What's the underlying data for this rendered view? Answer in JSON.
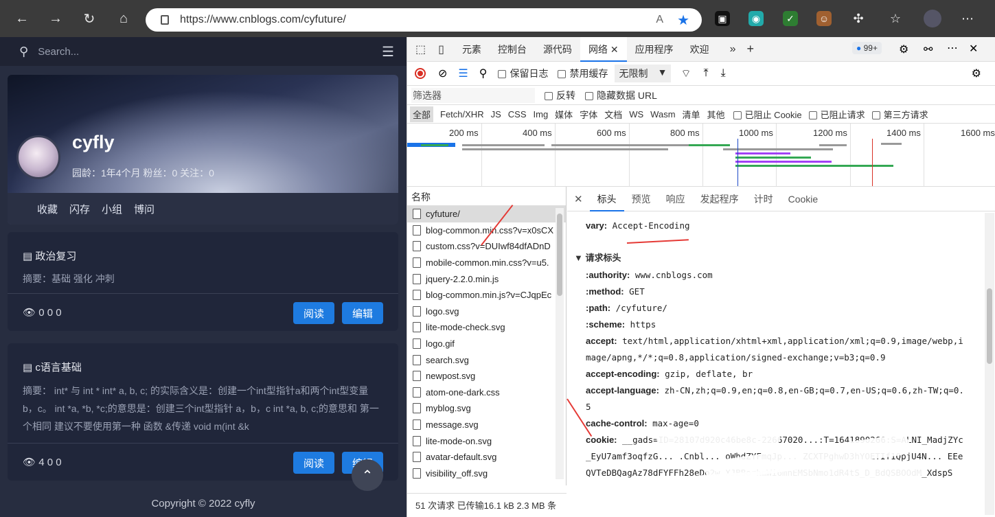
{
  "browser": {
    "url": "https://www.cnblogs.com/cyfuture/",
    "read_aloud": "A",
    "ext_badge": "99+"
  },
  "blog": {
    "search_placeholder": "Search...",
    "name": "cyfly",
    "stats": "园龄：1年4个月   粉丝：0   关注：0",
    "nav": [
      "收藏",
      "闪存",
      "小组",
      "博问"
    ],
    "posts": [
      {
        "title": "政治复习",
        "summary": "摘要：基础 强化 冲刺",
        "stats": "0  0  0",
        "read": "阅读",
        "edit": "编辑"
      },
      {
        "title": "c语言基础",
        "summary": "摘要： int* 与 int * int* a, b, c; 的实际含义是：创建一个int型指针a和两个int型变量b，c。 int *a, *b, *c;的意思是：创建三个int型指针 a，b，c int *a, b, c;的意思和 第一个相同 建议不要使用第一种 函数 &传递 void m(int &k",
        "stats": "4  0  0",
        "read": "阅读",
        "edit": "编辑"
      }
    ],
    "copyright": "Copyright © 2022 cyfly"
  },
  "devtools": {
    "tabs": [
      "元素",
      "控制台",
      "源代码",
      "网络",
      "应用程序",
      "欢迎"
    ],
    "active_tab": "网络",
    "toolbar": {
      "preserve_log": "保留日志",
      "disable_cache": "禁用缓存",
      "throttle": "无限制"
    },
    "filter": {
      "placeholder": "筛选器",
      "invert": "反转",
      "hide_data_url": "隐藏数据 URL"
    },
    "types": [
      "全部",
      "Fetch/XHR",
      "JS",
      "CSS",
      "Img",
      "媒体",
      "字体",
      "文档",
      "WS",
      "Wasm",
      "清单",
      "其他"
    ],
    "type_checks": [
      "已阻止 Cookie",
      "已阻止请求",
      "第三方请求"
    ],
    "timeline_ticks": [
      "200 ms",
      "400 ms",
      "600 ms",
      "800 ms",
      "1000 ms",
      "1200 ms",
      "1400 ms",
      "1600 ms"
    ],
    "name_header": "名称",
    "files": [
      "cyfuture/",
      "blog-common.min.css?v=x0sCX",
      "custom.css?v=DUIwf84dfADnD",
      "mobile-common.min.css?v=u5.",
      "jquery-2.2.0.min.js",
      "blog-common.min.js?v=CJqpEc",
      "logo.svg",
      "lite-mode-check.svg",
      "logo.gif",
      "search.svg",
      "newpost.svg",
      "atom-one-dark.css",
      "myblog.svg",
      "message.svg",
      "lite-mode-on.svg",
      "avatar-default.svg",
      "visibility_off.svg"
    ],
    "status": "51 次请求  已传输16.1 kB  2.3 MB 条",
    "detail_tabs": [
      "标头",
      "预览",
      "响应",
      "发起程序",
      "计时",
      "Cookie"
    ],
    "vary_key": "vary:",
    "vary_val": "Accept-Encoding",
    "section": "▼ 请求标头",
    "headers": [
      {
        "k": ":authority:",
        "v": "www.cnblogs.com"
      },
      {
        "k": ":method:",
        "v": "GET"
      },
      {
        "k": ":path:",
        "v": "/cyfuture/"
      },
      {
        "k": ":scheme:",
        "v": "https"
      },
      {
        "k": "accept:",
        "v": "text/html,application/xhtml+xml,application/xml;q=0.9,image/webp,image/apng,*/*;q=0.8,application/signed-exchange;v=b3;q=0.9"
      },
      {
        "k": "accept-encoding:",
        "v": "gzip, deflate, br"
      },
      {
        "k": "accept-language:",
        "v": "zh-CN,zh;q=0.9,en;q=0.8,en-GB;q=0.7,en-US;q=0.6,zh-TW;q=0.5"
      },
      {
        "k": "cache-control:",
        "v": "max-age=0"
      },
      {
        "k": "cookie:",
        "v": "__gads=ID=28107d920c46be8c-22667020...:T=1641890266:S=ALNI_MadjZYc_EyU7amf3oqfzG... .Cnbl... oWhdZYFmqJp... ZCXTPghwD3hYOETIf1QpjU4N... EEeQVTeDBQagAz78dFYFFh28eDo2w XJBBorhmWi6mhEMSbNmo1dR4tS_D_BdQSBOOdM_XdspS"
      }
    ],
    "colors": {
      "accent": "#1a73e8",
      "arrow": "#e53935"
    }
  }
}
